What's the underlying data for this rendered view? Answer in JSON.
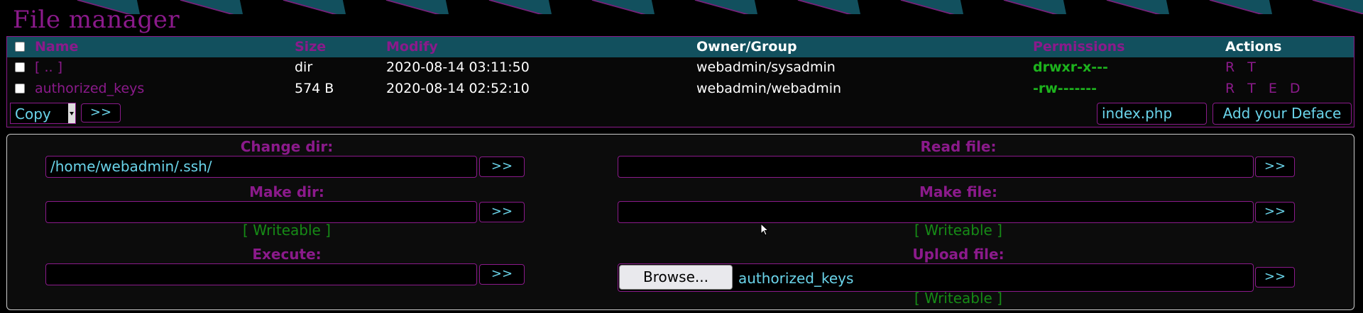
{
  "title": "File manager",
  "table": {
    "headers": [
      "Name",
      "Size",
      "Modify",
      "Owner/Group",
      "Permissions",
      "Actions"
    ],
    "rows": [
      {
        "name": "[ .. ]",
        "size": "dir",
        "modify": "2020-08-14 03:11:50",
        "owner": "webadmin/sysadmin",
        "perms": "drwxr-x---",
        "actions": "R T"
      },
      {
        "name": "authorized_keys",
        "size": "574 B",
        "modify": "2020-08-14 02:52:10",
        "owner": "webadmin/webadmin",
        "perms": "-rw-------",
        "actions": "R T E D"
      }
    ]
  },
  "footer": {
    "action_select": "Copy",
    "go_label": ">>",
    "deface_file": "index.php",
    "deface_button": "Add your Deface"
  },
  "tools": {
    "change_dir": {
      "label": "Change dir:",
      "value": "/home/webadmin/.ssh/",
      "button": ">>"
    },
    "read_file": {
      "label": "Read file:",
      "value": "",
      "button": ">>"
    },
    "make_dir": {
      "label": "Make dir:",
      "value": "",
      "button": ">>",
      "status": "[ Writeable ]"
    },
    "make_file": {
      "label": "Make file:",
      "value": "",
      "button": ">>",
      "status": "[ Writeable ]"
    },
    "execute": {
      "label": "Execute:",
      "value": "",
      "button": ">>"
    },
    "upload_file": {
      "label": "Upload file:",
      "browse": "Browse...",
      "filename": "authorized_keys",
      "button": ">>",
      "status": "[ Writeable ]"
    }
  },
  "colors": {
    "accent": "#8b1a8b",
    "header_bg": "#12505e",
    "input_text": "#6ad4ea",
    "perm_green": "#1db31d"
  }
}
